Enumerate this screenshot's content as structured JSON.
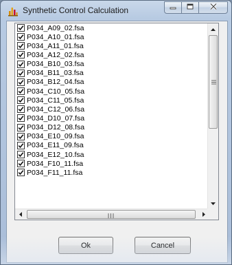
{
  "window": {
    "title": "Synthetic Control Calculation",
    "icon": "chart-bars-icon",
    "controls": [
      "minimize-icon",
      "maximize-icon",
      "close-icon"
    ]
  },
  "files": [
    {
      "label": "P034_A09_02.fsa",
      "checked": true
    },
    {
      "label": "P034_A10_01.fsa",
      "checked": true
    },
    {
      "label": "P034_A11_01.fsa",
      "checked": true
    },
    {
      "label": "P034_A12_02.fsa",
      "checked": true
    },
    {
      "label": "P034_B10_03.fsa",
      "checked": true
    },
    {
      "label": "P034_B11_03.fsa",
      "checked": true
    },
    {
      "label": "P034_B12_04.fsa",
      "checked": true
    },
    {
      "label": "P034_C10_05.fsa",
      "checked": true
    },
    {
      "label": "P034_C11_05.fsa",
      "checked": true
    },
    {
      "label": "P034_C12_06.fsa",
      "checked": true
    },
    {
      "label": "P034_D10_07.fsa",
      "checked": true
    },
    {
      "label": "P034_D12_08.fsa",
      "checked": true
    },
    {
      "label": "P034_E10_09.fsa",
      "checked": true
    },
    {
      "label": "P034_E11_09.fsa",
      "checked": true
    },
    {
      "label": "P034_E12_10.fsa",
      "checked": true
    },
    {
      "label": "P034_F10_11.fsa",
      "checked": true
    },
    {
      "label": "P034_F11_11.fsa",
      "checked": true
    }
  ],
  "buttons": {
    "ok": "Ok",
    "cancel": "Cancel"
  }
}
